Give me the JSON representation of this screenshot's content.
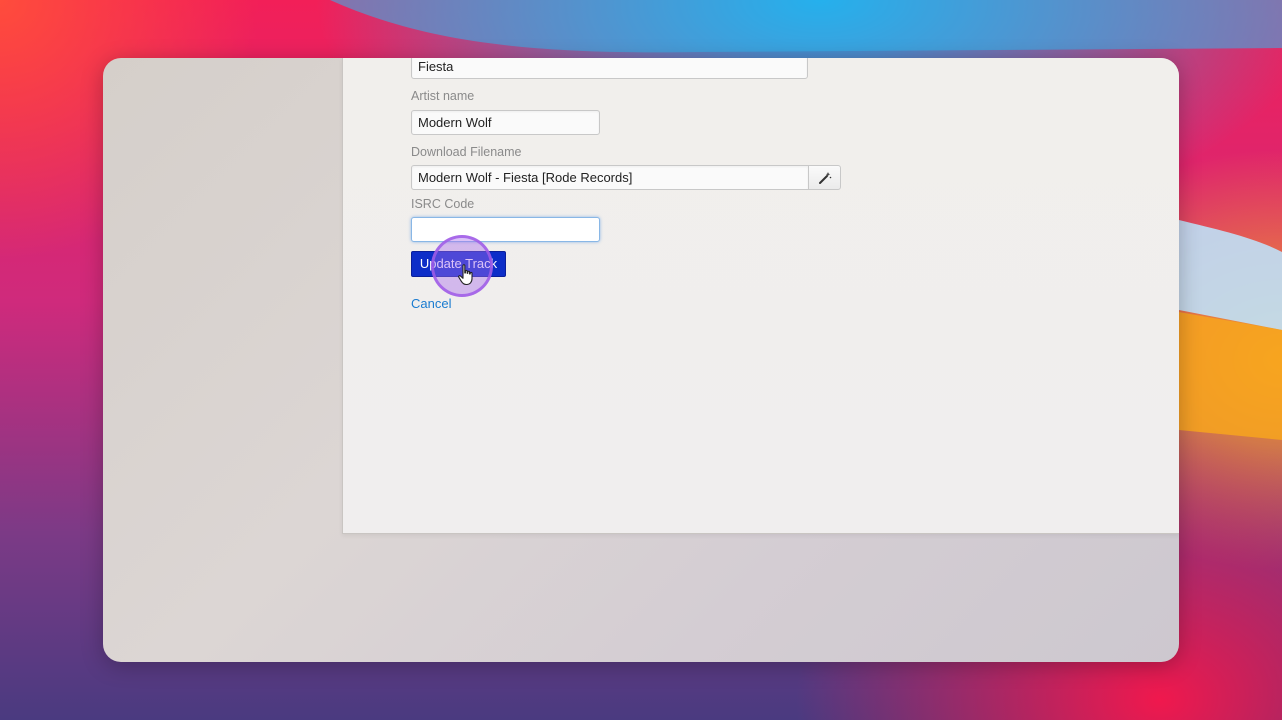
{
  "form": {
    "track_title_value": "Fiesta",
    "artist_label": "Artist name",
    "artist_value": "Modern Wolf",
    "filename_label": "Download Filename",
    "filename_value": "Modern Wolf - Fiesta [Rode Records]",
    "isrc_label": "ISRC Code",
    "isrc_value": "",
    "submit_label": "Update Track",
    "cancel_label": "Cancel"
  },
  "icons": {
    "generate_filename": "magic-wand-icon",
    "pointer": "hand-pointer-icon"
  },
  "colors": {
    "submit_bg": "#0d2ec8",
    "cancel_link": "#1a7bd0",
    "click_highlight": "#a05ae6"
  }
}
